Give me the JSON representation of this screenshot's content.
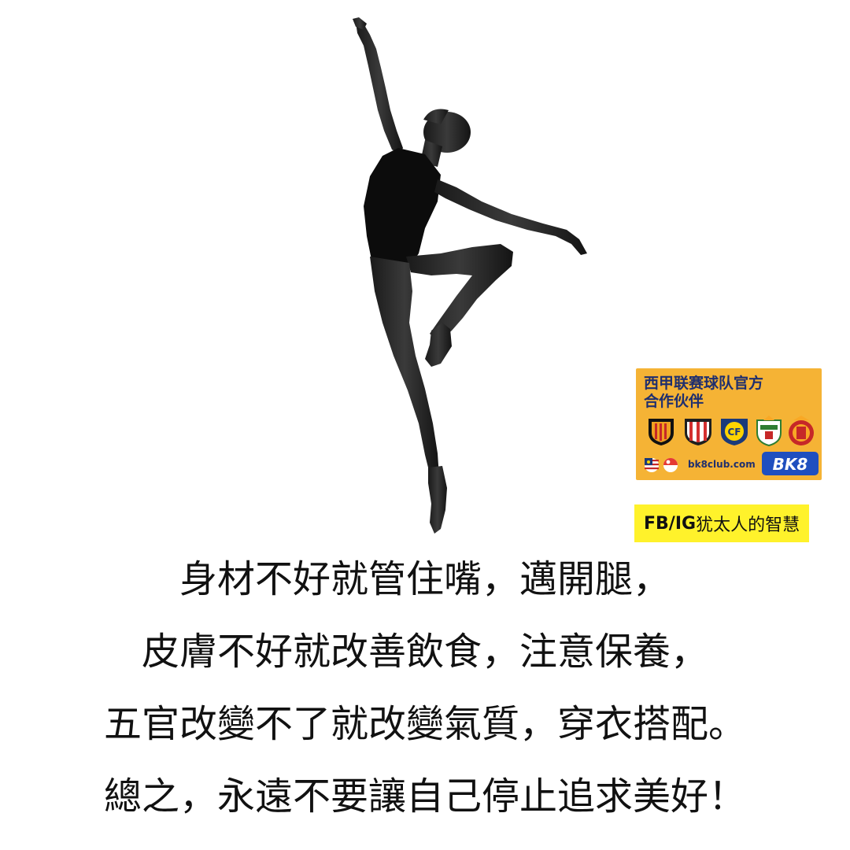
{
  "sponsor": {
    "line1": "西甲联赛球队官方",
    "line2": "合作伙伴",
    "site": "bk8club.com",
    "logo_text": "BK8",
    "crest_icons": [
      "valencia-crest-icon",
      "athletic-bilbao-crest-icon",
      "villarreal-crest-icon",
      "elche-crest-icon",
      "mallorca-crest-icon"
    ],
    "flag_icons": [
      "malaysia-flag-icon",
      "singapore-flag-icon"
    ],
    "card_color": "#f5b335",
    "text_color": "#1f2f6e"
  },
  "social_tag": {
    "platforms": "FB/IG",
    "handle": "犹太人的智慧",
    "color": "#fff22b"
  },
  "quote": {
    "line1": "身材不好就管住嘴，邁開腿，",
    "line2": "皮膚不好就改善飲食，注意保養，",
    "line3": "五官改變不了就改變氣質，穿衣搭配。",
    "line4": "總之，永遠不要讓自己停止追求美好！"
  },
  "image": {
    "subject": "ballerina-silhouette"
  }
}
